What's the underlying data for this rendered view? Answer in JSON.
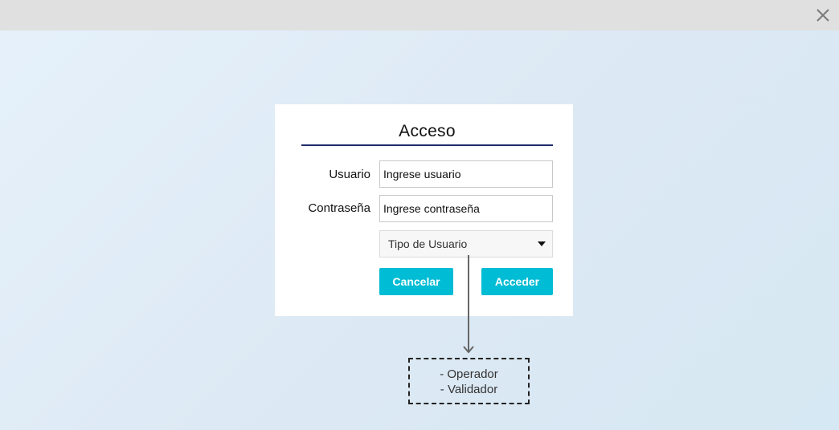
{
  "window": {
    "close_icon": "close-icon"
  },
  "dialog": {
    "title": "Acceso",
    "title_rule_color": "#1f2d6b",
    "username": {
      "label": "Usuario",
      "value": "Ingrese usuario"
    },
    "password": {
      "label": "Contraseña",
      "value": "Ingrese contraseña"
    },
    "user_type": {
      "selected": "Tipo de Usuario",
      "caret_icon": "caret-down-icon"
    },
    "buttons": {
      "cancel_label": "Cancelar",
      "submit_label": "Acceder",
      "color": "#00bcd4"
    }
  },
  "annotation": {
    "options": [
      "- Operador",
      "- Validador"
    ]
  }
}
